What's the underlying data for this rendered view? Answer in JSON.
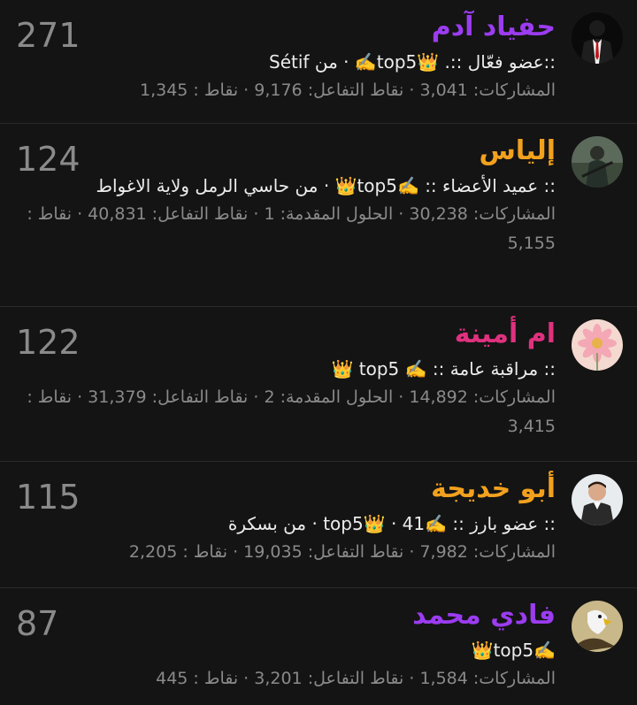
{
  "members": [
    {
      "name": "حفياد آدم",
      "name_color": "#9b3cf0",
      "avatar": "suit-avatar-icon",
      "title": "::عضو فعّال ::. 👑top5✍️ · من Sétif",
      "stats": "المشاركات: 3,041 · نقاط التفاعل: 9,176 · نقاط : 1,345",
      "score": "271"
    },
    {
      "name": "إلياس",
      "name_color": "#f2a11e",
      "avatar": "soldier-avatar-icon",
      "title": ":: عميد الأعضاء :: ✍️top5👑 · من حاسي الرمل ولاية الاغواط",
      "stats": "المشاركات: 30,238 · الحلول المقدمة: 1 · نقاط التفاعل: 40,831 · نقاط : 5,155",
      "score": "124"
    },
    {
      "name": "ام أمينة",
      "name_color": "#e0317f",
      "avatar": "flower-avatar-icon",
      "title": ":: مراقبة عامة :: ✍️ top5 👑",
      "stats": "المشاركات: 14,892 · الحلول المقدمة: 2 · نقاط التفاعل: 31,379 · نقاط : 3,415",
      "score": "122"
    },
    {
      "name": "أبو خديجة",
      "name_color": "#f2a11e",
      "avatar": "man-avatar-icon",
      "title": ":: عضو بارز :: ✍️top5👑 · 41 · من بسكرة",
      "stats": "المشاركات: 7,982 · نقاط التفاعل: 19,035 · نقاط : 2,205",
      "score": "115"
    },
    {
      "name": "فادي محمد",
      "name_color": "#9b3cf0",
      "avatar": "eagle-avatar-icon",
      "title": "✍️top5👑",
      "stats": "المشاركات: 1,584 · نقاط التفاعل: 3,201 · نقاط : 445",
      "score": "87"
    }
  ]
}
